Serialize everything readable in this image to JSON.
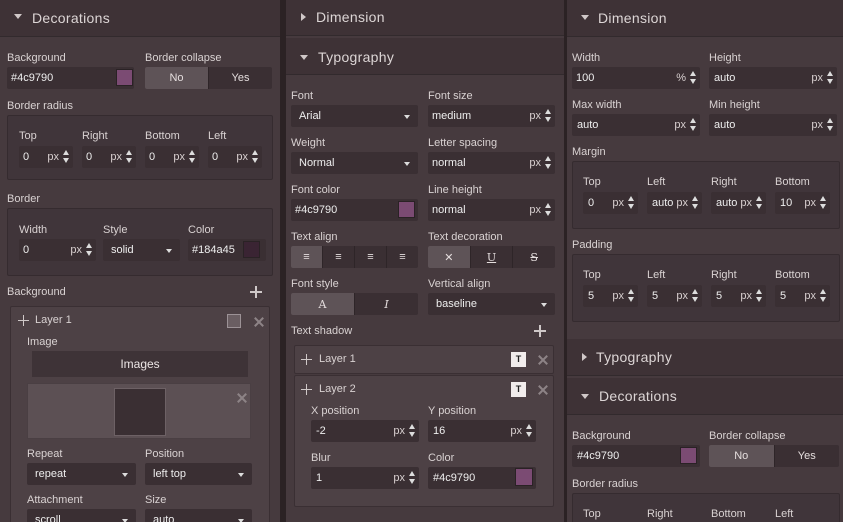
{
  "left": {
    "decorations_title": "Decorations",
    "background_label": "Background",
    "background_value": "#4c9790",
    "background_color": "#7b4b73",
    "border_collapse_label": "Border collapse",
    "bc_no": "No",
    "bc_yes": "Yes",
    "border_radius_label": "Border radius",
    "radius": [
      {
        "label": "Top",
        "value": "0",
        "unit": "px"
      },
      {
        "label": "Right",
        "value": "0",
        "unit": "px"
      },
      {
        "label": "Bottom",
        "value": "0",
        "unit": "px"
      },
      {
        "label": "Left",
        "value": "0",
        "unit": "px"
      }
    ],
    "border_label": "Border",
    "border_width_label": "Width",
    "border_width_value": "0",
    "border_width_unit": "px",
    "border_style_label": "Style",
    "border_style_value": "solid",
    "border_color_label": "Color",
    "border_color_value": "#184a45",
    "border_color": "#3a2433",
    "bg_label": "Background",
    "layer1": "Layer 1",
    "image_label": "Image",
    "images_btn": "Images",
    "repeat_label": "Repeat",
    "repeat_value": "repeat",
    "position_label": "Position",
    "position_value": "left top",
    "attachment_label": "Attachment",
    "attachment_value": "scroll",
    "size_label": "Size",
    "size_value": "auto"
  },
  "mid": {
    "dimension_title": "Dimension",
    "typography_title": "Typography",
    "font_label": "Font",
    "font_value": "Arial",
    "font_size_label": "Font size",
    "font_size_value": "medium",
    "font_size_unit": "px",
    "weight_label": "Weight",
    "weight_value": "Normal",
    "letter_spacing_label": "Letter spacing",
    "letter_spacing_value": "normal",
    "letter_spacing_unit": "px",
    "font_color_label": "Font color",
    "font_color_value": "#4c9790",
    "font_color": "#7b4b73",
    "line_height_label": "Line height",
    "line_height_value": "normal",
    "line_height_unit": "px",
    "text_align_label": "Text align",
    "text_decoration_label": "Text decoration",
    "font_style_label": "Font style",
    "vertical_align_label": "Vertical align",
    "vertical_align_value": "baseline",
    "text_shadow_label": "Text shadow",
    "layer1": "Layer 1",
    "layer2": "Layer 2",
    "xpos_label": "X position",
    "xpos_value": "-2",
    "xpos_unit": "px",
    "ypos_label": "Y position",
    "ypos_value": "16",
    "ypos_unit": "px",
    "blur_label": "Blur",
    "blur_value": "1",
    "blur_unit": "px",
    "color_label": "Color",
    "color_value": "#4c9790",
    "color": "#7b4b73"
  },
  "right": {
    "dimension_title": "Dimension",
    "width_label": "Width",
    "width_value": "100",
    "width_unit": "%",
    "height_label": "Height",
    "height_value": "auto",
    "height_unit": "px",
    "max_width_label": "Max width",
    "max_width_value": "auto",
    "max_width_unit": "px",
    "min_height_label": "Min height",
    "min_height_value": "auto",
    "min_height_unit": "px",
    "margin_label": "Margin",
    "margin": [
      {
        "label": "Top",
        "value": "0",
        "unit": "px"
      },
      {
        "label": "Left",
        "value": "auto",
        "unit": "px"
      },
      {
        "label": "Right",
        "value": "auto",
        "unit": "px"
      },
      {
        "label": "Bottom",
        "value": "10",
        "unit": "px"
      }
    ],
    "padding_label": "Padding",
    "padding": [
      {
        "label": "Top",
        "value": "5",
        "unit": "px"
      },
      {
        "label": "Left",
        "value": "5",
        "unit": "px"
      },
      {
        "label": "Right",
        "value": "5",
        "unit": "px"
      },
      {
        "label": "Bottom",
        "value": "5",
        "unit": "px"
      }
    ],
    "typography_title": "Typography",
    "decorations_title": "Decorations",
    "background_label": "Background",
    "background_value": "#4c9790",
    "background_color": "#7b4b73",
    "border_collapse_label": "Border collapse",
    "bc_no": "No",
    "bc_yes": "Yes",
    "border_radius_label": "Border radius",
    "radius": [
      {
        "label": "Top"
      },
      {
        "label": "Right"
      },
      {
        "label": "Bottom"
      },
      {
        "label": "Left"
      }
    ]
  }
}
